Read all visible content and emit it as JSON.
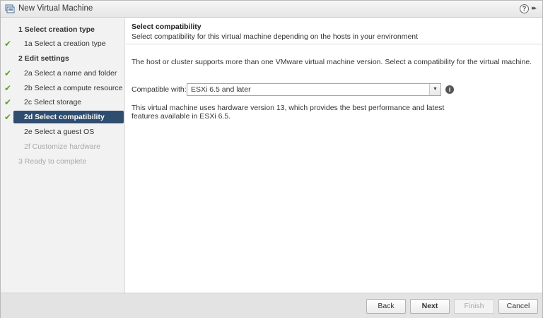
{
  "window": {
    "title": "New Virtual Machine",
    "help_glyph": "?",
    "expand_glyph": "▸▸"
  },
  "sidebar": {
    "steps": [
      {
        "label": "1  Select creation type",
        "level": "top",
        "done": false,
        "state": "normal"
      },
      {
        "label": "1a  Select a creation type",
        "level": "sub",
        "done": true,
        "state": "normal"
      },
      {
        "label": "2  Edit settings",
        "level": "top",
        "done": false,
        "state": "normal"
      },
      {
        "label": "2a  Select a name and folder",
        "level": "sub",
        "done": true,
        "state": "normal"
      },
      {
        "label": "2b  Select a compute resource",
        "level": "sub",
        "done": true,
        "state": "normal"
      },
      {
        "label": "2c  Select storage",
        "level": "sub",
        "done": true,
        "state": "normal"
      },
      {
        "label": "2d  Select compatibility",
        "level": "sub",
        "done": true,
        "state": "active"
      },
      {
        "label": "2e  Select a guest OS",
        "level": "sub",
        "done": false,
        "state": "normal"
      },
      {
        "label": "2f  Customize hardware",
        "level": "sub",
        "done": false,
        "state": "disabled"
      },
      {
        "label": "3  Ready to complete",
        "level": "top",
        "done": false,
        "state": "disabled"
      }
    ]
  },
  "main": {
    "title": "Select compatibility",
    "subtitle": "Select compatibility for this virtual machine depending on the hosts in your environment",
    "intro": "The host or cluster supports more than one VMware virtual machine version. Select a compatibility for the virtual machine.",
    "compat_label": "Compatible with:",
    "compat_value": "ESXi 6.5 and later",
    "info_glyph": "i",
    "hw_text": "This virtual machine uses hardware version 13, which provides the best performance and latest features available in ESXi 6.5."
  },
  "footer": {
    "back": "Back",
    "next": "Next",
    "finish": "Finish",
    "cancel": "Cancel"
  },
  "colors": {
    "active_step": "#2f4d6f",
    "check": "#5aa02c"
  }
}
